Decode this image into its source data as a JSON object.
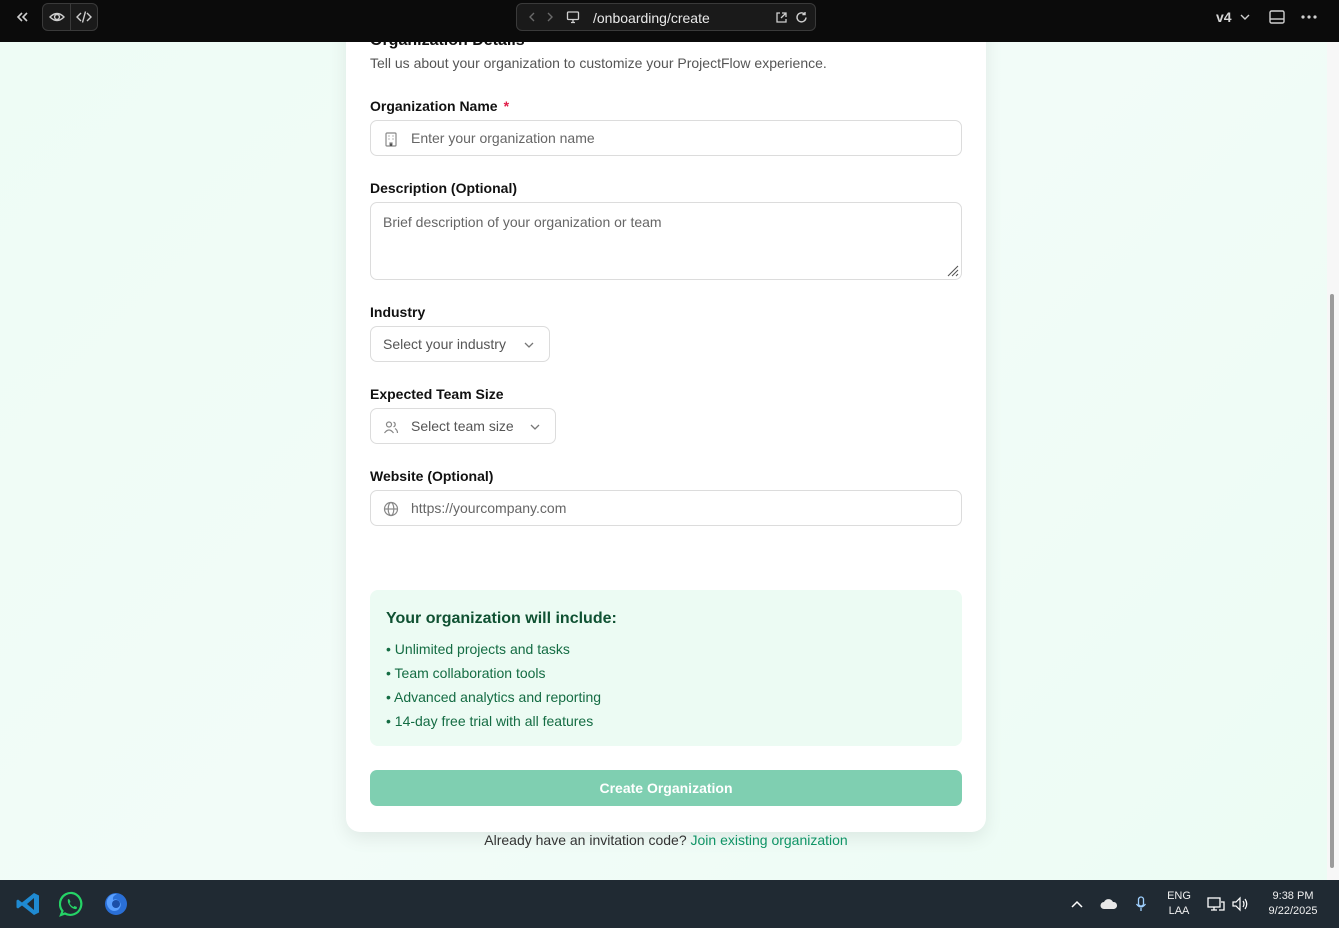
{
  "browser": {
    "url": "/onboarding/create",
    "version": "v4"
  },
  "form": {
    "section_title": "Organization Details",
    "subtitle": "Tell us about your organization to customize your ProjectFlow experience.",
    "org_name_label": "Organization Name",
    "required_mark": "*",
    "org_name_placeholder": "Enter your organization name",
    "description_label": "Description (Optional)",
    "description_placeholder": "Brief description of your organization or team",
    "industry_label": "Industry",
    "industry_value": "Select your industry",
    "team_size_label": "Expected Team Size",
    "team_size_value": "Select team size",
    "website_label": "Website (Optional)",
    "website_placeholder": "https://yourcompany.com"
  },
  "features": {
    "title": "Your organization will include:",
    "items": [
      "• Unlimited projects and tasks",
      "• Team collaboration tools",
      "• Advanced analytics and reporting",
      "• 14-day free trial with all features"
    ]
  },
  "create_button": "Create Organization",
  "invite": {
    "text": "Already have an invitation code?",
    "link": "Join existing organization"
  },
  "taskbar": {
    "lang_top": "ENG",
    "lang_bottom": "LAA",
    "time": "9:38 PM",
    "date": "9/22/2025"
  },
  "colors": {
    "accent": "#0f9466",
    "button_disabled": "#7fcfb1",
    "feature_bg": "#ecfbf3",
    "page_bg": "#eefcf5"
  },
  "icons": [
    "collapse-icon",
    "eye-icon",
    "code-icon",
    "back-icon",
    "forward-icon",
    "monitor-icon",
    "external-link-icon",
    "refresh-icon",
    "chevron-down-icon",
    "layout-icon",
    "more-icon",
    "building-icon",
    "users-icon",
    "globe-icon",
    "vscode-icon",
    "whatsapp-icon",
    "firefox-icon",
    "chevron-up-icon",
    "cloud-icon",
    "mic-icon",
    "network-icon",
    "volume-icon"
  ]
}
